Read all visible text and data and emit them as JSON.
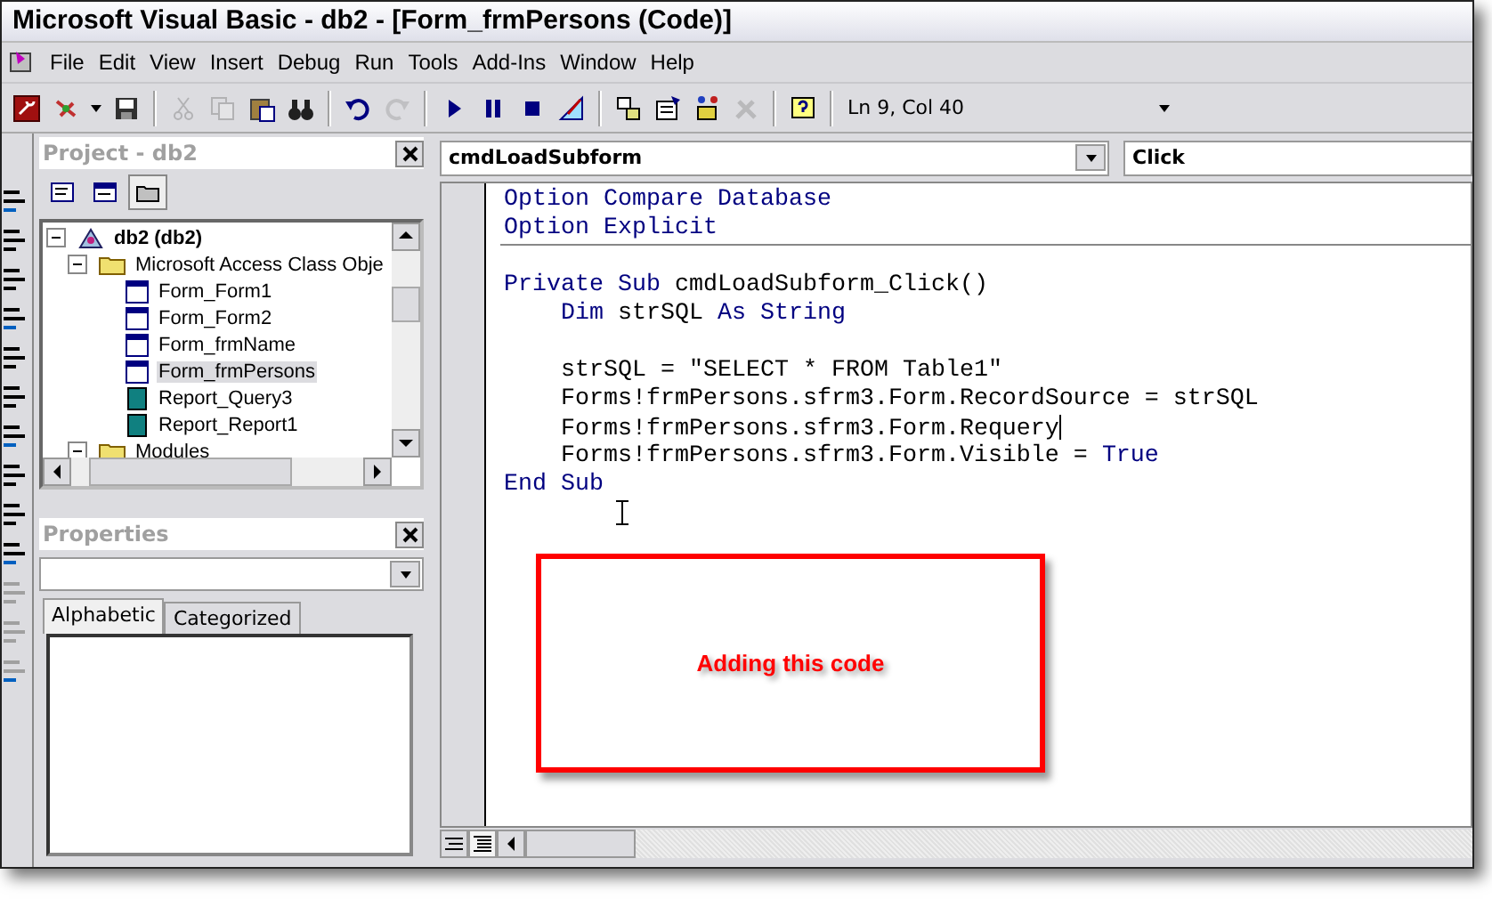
{
  "window": {
    "title": "Microsoft Visual Basic - db2 - [Form_frmPersons (Code)]"
  },
  "menu": [
    "File",
    "Edit",
    "View",
    "Insert",
    "Debug",
    "Run",
    "Tools",
    "Add-Ins",
    "Window",
    "Help"
  ],
  "toolbar": {
    "buttons": [
      {
        "disabled": false
      },
      {
        "disabled": false
      },
      {
        "disabled": false
      },
      {
        "disabled": true
      },
      {
        "disabled": true
      },
      {
        "disabled": false
      },
      {
        "disabled": false
      },
      {
        "disabled": false
      },
      {
        "disabled": true
      },
      {
        "disabled": false
      },
      {
        "disabled": false
      },
      {
        "disabled": false
      },
      {
        "disabled": false
      },
      {
        "disabled": false
      },
      {
        "disabled": false
      },
      {
        "disabled": false
      },
      {
        "disabled": true
      },
      {
        "disabled": false
      }
    ],
    "position": "Ln 9, Col 40"
  },
  "project": {
    "title": "Project - db2",
    "tree": [
      {
        "label": "db2 (db2)",
        "expanded": true,
        "selected": false,
        "children": [
          {
            "label": "Microsoft Access Class Obje",
            "expanded": true,
            "selected": false,
            "children": [
              {
                "label": "Form_Form1",
                "selected": false
              },
              {
                "label": "Form_Form2",
                "selected": false
              },
              {
                "label": "Form_frmName",
                "selected": false
              },
              {
                "label": "Form_frmPersons",
                "selected": true
              },
              {
                "label": "Report_Query3",
                "selected": false
              },
              {
                "label": "Report_Report1",
                "selected": false
              }
            ]
          },
          {
            "label": "Modules",
            "expanded": true,
            "selected": false
          }
        ]
      }
    ]
  },
  "properties": {
    "title": "Properties",
    "tabs": [
      {
        "label": "Alphabetic",
        "selected": true
      },
      {
        "label": "Categorized",
        "selected": false
      }
    ]
  },
  "code": {
    "object": "cmdLoadSubform",
    "procedure": "Click",
    "sections": [
      {
        "blocks": [
          [
            [
              {
                "text": "Option Compare Database",
                "kind": "keyword"
              }
            ],
            [
              {
                "text": "Option Explicit",
                "kind": "keyword"
              }
            ]
          ]
        ]
      },
      {
        "blocks": [
          [
            [
              {
                "text": "Private Sub",
                "kind": "keyword"
              },
              {
                "text": " cmdLoadSubform_Click()",
                "kind": "plain"
              }
            ],
            [
              {
                "text": "    Dim",
                "kind": "keyword"
              },
              {
                "text": " strSQL ",
                "kind": "plain"
              },
              {
                "text": "As String",
                "kind": "keyword"
              }
            ]
          ],
          [
            [
              {
                "text": "    strSQL = \"SELECT * FROM Table1\"",
                "kind": "plain"
              }
            ],
            [
              {
                "text": "    Forms!frmPersons.sfrm3.Form.RecordSource = strSQL",
                "kind": "plain"
              }
            ],
            [
              {
                "text": "    Forms!frmPersons.sfrm3.Form.Requery",
                "kind": "plain"
              }
            ],
            [
              {
                "text": "    Forms!frmPersons.sfrm3.Form.Visible = ",
                "kind": "plain"
              },
              {
                "text": "True",
                "kind": "keyword"
              }
            ],
            [
              {
                "text": "End Sub",
                "kind": "keyword"
              }
            ]
          ]
        ]
      }
    ],
    "annotation": "Adding this code"
  }
}
